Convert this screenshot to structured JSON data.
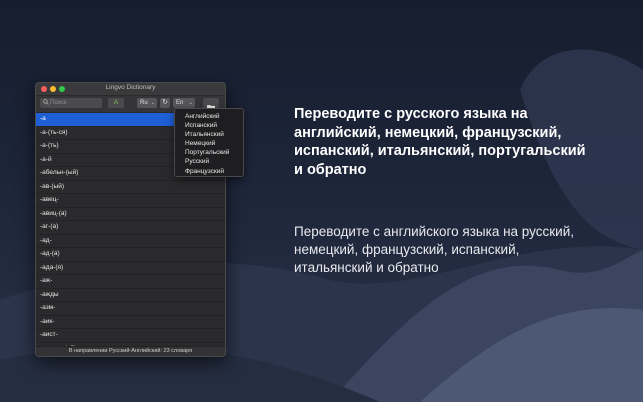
{
  "window": {
    "title": "Lingvo Dictionary",
    "search_placeholder": "Поиск",
    "a_button": "A",
    "source_lang": "Ru",
    "target_lang": "En",
    "status": "В направлении Русский-Английский: 23 словаря"
  },
  "entries": [
    "-а",
    "-а-(ть-ся)",
    "-а-(ть)",
    "-а-й",
    "-абельн-(ый)",
    "-ав-(ый)",
    "-авец-",
    "-авиц-(а)",
    "-аг-(а)",
    "-ад-",
    "-ад-(а)",
    "-ада-(я)",
    "-аж-",
    "-ажды",
    "-азм-",
    "-аик-",
    "-аист-",
    "-аическ-(ий)"
  ],
  "language_menu": [
    "Английский",
    "Испанский",
    "Итальянский",
    "Немецкий",
    "Португальский",
    "Русский",
    "Французский"
  ],
  "promo": {
    "heading": "Переводите с русского языка на английский, немецкий, французский, испанский, итальянский, португальский и обратно",
    "subtext": "Переводите с английского языка на русский, немецкий, французский, испанский, итальянский и обратно"
  },
  "colors": {
    "accent": "#1f5fd6",
    "background": "#1c2438"
  }
}
